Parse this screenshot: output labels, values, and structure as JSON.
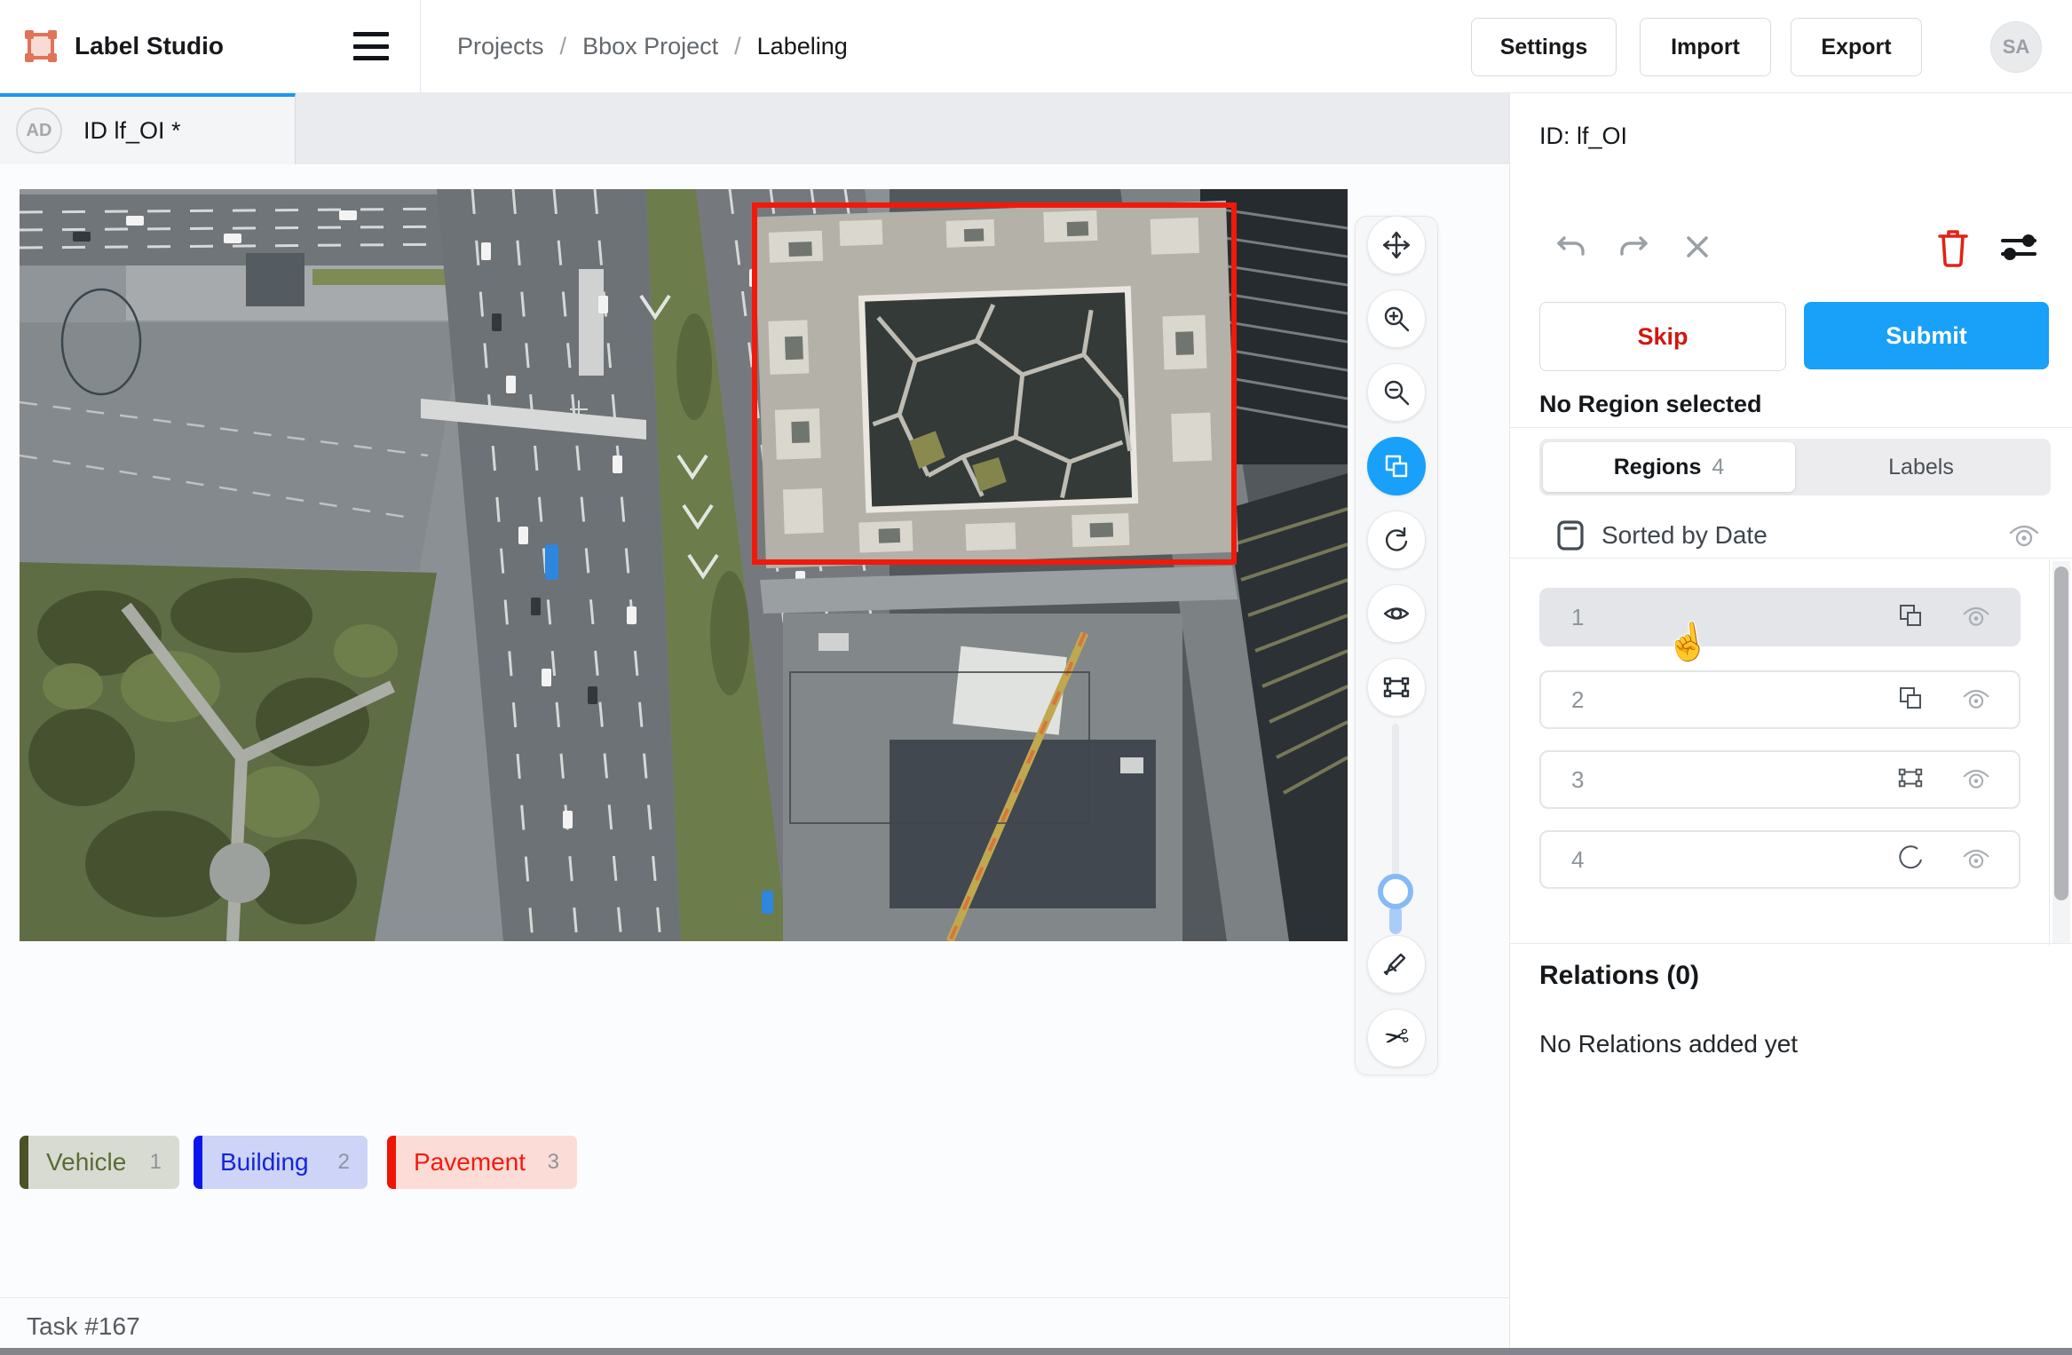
{
  "header": {
    "app_name": "Label Studio",
    "logo_icon": "bbox-logo-icon",
    "menu_icon": "hamburger-icon",
    "breadcrumbs": {
      "projects": "Projects",
      "sep1": "/",
      "project": "Bbox Project",
      "sep2": "/",
      "current": "Labeling"
    },
    "settings_label": "Settings",
    "import_label": "Import",
    "export_label": "Export",
    "avatar_initials": "SA"
  },
  "tab": {
    "avatar_initials": "AD",
    "title": "ID lf_OI *"
  },
  "canvas": {
    "content": "aerial photo of highway interchange, park and buildings",
    "annotations": {
      "red_bbox_color": "#f2190b",
      "selected_region": "rectangle around courtyard building",
      "other_regions": [
        "ellipse outline top-left",
        "faint rectangle over construction site"
      ]
    }
  },
  "toolbar": {
    "tools": [
      "move",
      "zoom-in",
      "zoom-out",
      "rect-multi",
      "rotate",
      "eye",
      "bbox",
      "brush",
      "scissors"
    ],
    "selected_tool": "rect-multi",
    "selected_color": "#18a0fb",
    "zoom_slider": {
      "orientation": "vertical",
      "thumb_color": "#86baf6"
    }
  },
  "sidebar": {
    "task_id": "ID: lf_OI",
    "history_icons": [
      "undo-icon",
      "redo-icon",
      "close-icon"
    ],
    "action_icons": [
      "trash-icon",
      "filter-sliders-icon"
    ],
    "trash_color": "#e02417",
    "skip_label": "Skip",
    "submit_label": "Submit",
    "submit_color": "#19a0f8",
    "no_region_text": "No Region selected",
    "tabs": {
      "regions_label": "Regions",
      "regions_count": "4",
      "labels_label": "Labels",
      "active": "Regions"
    },
    "sort": {
      "icon": "journal-icon",
      "label": "Sorted by Date",
      "visibility_icon": "eye-icon"
    },
    "regions": [
      {
        "number": "1",
        "type_icon": "rect-multi-icon",
        "visibility_icon": "eye-icon",
        "state": "hovered"
      },
      {
        "number": "2",
        "type_icon": "rect-multi-icon",
        "visibility_icon": "eye-icon",
        "state": "normal"
      },
      {
        "number": "3",
        "type_icon": "bbox-icon",
        "visibility_icon": "eye-icon",
        "state": "normal"
      },
      {
        "number": "4",
        "type_icon": "ellipse-arc-icon",
        "visibility_icon": "eye-icon",
        "state": "normal"
      }
    ],
    "relations_title": "Relations (0)",
    "relations_empty": "No Relations added yet"
  },
  "labels": [
    {
      "name": "Vehicle",
      "hotkey": "1",
      "text_color": "#5c6b33",
      "bar_color": "#4b5226",
      "bg_color": "#d7dbd2"
    },
    {
      "name": "Building",
      "hotkey": "2",
      "text_color": "#1524dd",
      "bar_color": "#0b16ee",
      "bg_color": "#cdd4f7"
    },
    {
      "name": "Pavement",
      "hotkey": "3",
      "text_color": "#f41b0d",
      "bar_color": "#ee1505",
      "bg_color": "#fcdcd7"
    }
  ],
  "footer": {
    "task_label": "Task #167"
  }
}
